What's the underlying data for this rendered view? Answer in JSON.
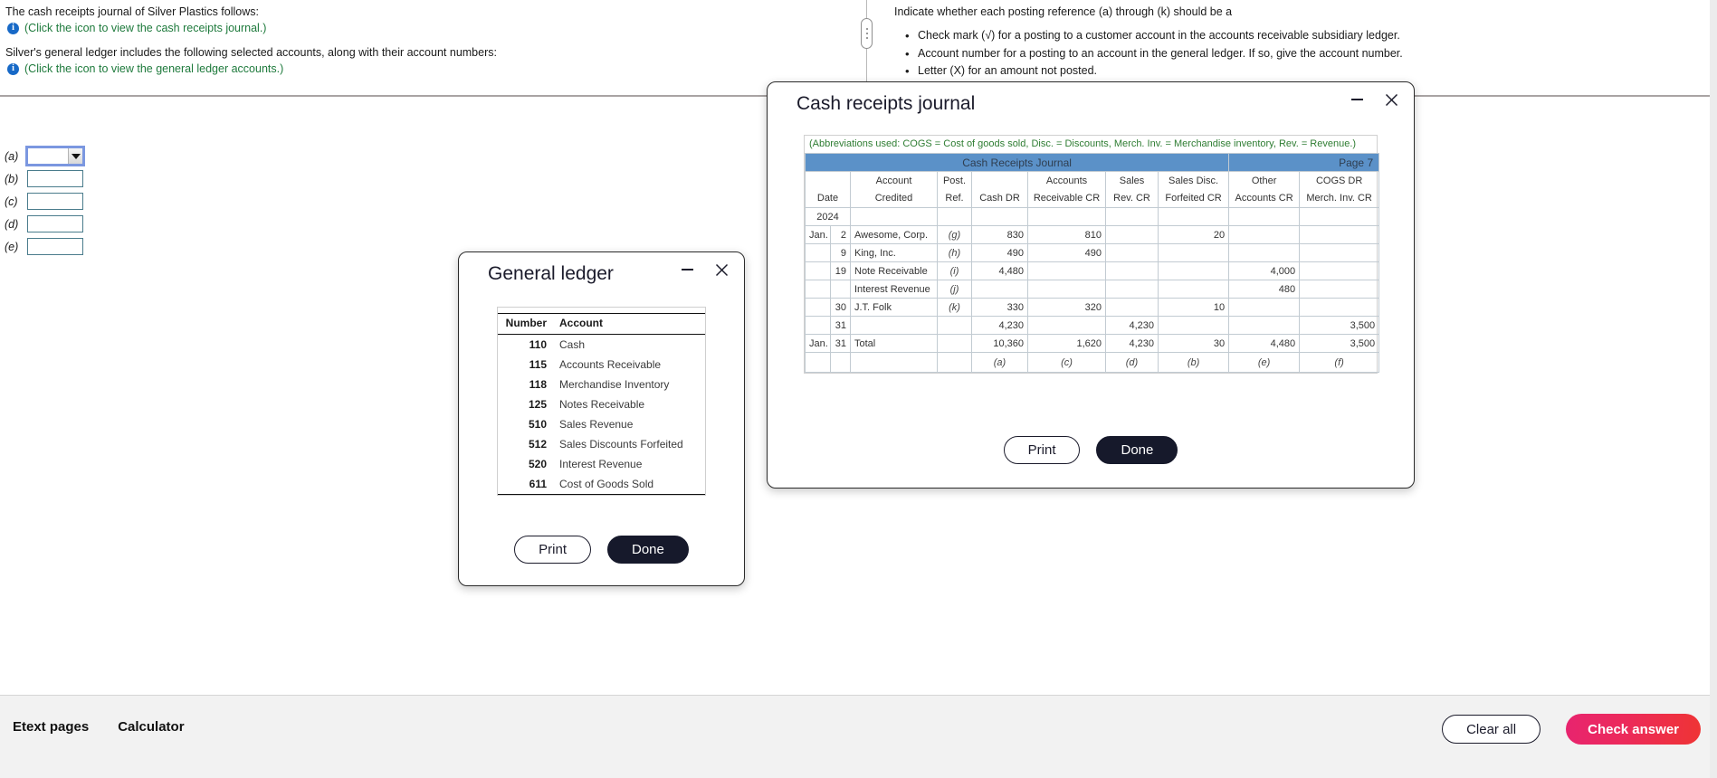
{
  "problem": {
    "left": {
      "line1": "The cash receipts journal of Silver Plastics follows:",
      "hint1": "(Click the icon to view the cash receipts journal.)",
      "line2": "Silver's general ledger includes the following selected accounts, along with their account numbers:",
      "hint2": "(Click the icon to view the general ledger accounts.)"
    },
    "right": {
      "prompt": "Indicate whether each posting reference (a) through (k) should be a",
      "bullets": [
        "Check mark (√) for a posting to a customer account in the accounts receivable subsidiary ledger.",
        "Account number for a posting to an account in the general ledger. If so, give the account number.",
        "Letter (X) for an amount not posted."
      ]
    }
  },
  "answers": {
    "rows": [
      {
        "label": "(a)",
        "value": "",
        "type": "dropdown",
        "focused": true
      },
      {
        "label": "(b)",
        "value": "",
        "type": "text",
        "focused": false
      },
      {
        "label": "(c)",
        "value": "",
        "type": "text",
        "focused": false
      },
      {
        "label": "(d)",
        "value": "",
        "type": "text",
        "focused": false
      },
      {
        "label": "(e)",
        "value": "",
        "type": "text",
        "focused": false
      }
    ]
  },
  "general_ledger_dialog": {
    "title": "General ledger",
    "columns": [
      "Number",
      "Account"
    ],
    "rows": [
      {
        "number": "110",
        "account": "Cash"
      },
      {
        "number": "115",
        "account": "Accounts Receivable"
      },
      {
        "number": "118",
        "account": "Merchandise Inventory"
      },
      {
        "number": "125",
        "account": "Notes Receivable"
      },
      {
        "number": "510",
        "account": "Sales Revenue"
      },
      {
        "number": "512",
        "account": "Sales Discounts Forfeited"
      },
      {
        "number": "520",
        "account": "Interest Revenue"
      },
      {
        "number": "611",
        "account": "Cost of Goods Sold"
      }
    ],
    "print_label": "Print",
    "done_label": "Done"
  },
  "cash_receipts_dialog": {
    "title": "Cash receipts journal",
    "abbreviations": "(Abbreviations used: COGS = Cost of goods sold, Disc. = Discounts, Merch. Inv. = Merchandise inventory, Rev. = Revenue.)",
    "banner_title": "Cash Receipts Journal",
    "page_label": "Page 7",
    "headers_top": [
      "",
      "Account",
      "Post.",
      "",
      "Accounts",
      "Sales",
      "Sales Disc.",
      "Other",
      "COGS DR"
    ],
    "headers_bottom": [
      "Date",
      "Credited",
      "Ref.",
      "Cash DR",
      "Receivable CR",
      "Rev. CR",
      "Forfeited CR",
      "Accounts CR",
      "Merch. Inv. CR"
    ],
    "year_row": "2024",
    "rows": [
      {
        "month": "Jan.",
        "day": "2",
        "account": "Awesome, Corp.",
        "ref": "(g)",
        "cash": "830",
        "ar": "810",
        "sales": "",
        "disc": "20",
        "other": "",
        "cogs": ""
      },
      {
        "month": "",
        "day": "9",
        "account": "King, Inc.",
        "ref": "(h)",
        "cash": "490",
        "ar": "490",
        "sales": "",
        "disc": "",
        "other": "",
        "cogs": ""
      },
      {
        "month": "",
        "day": "19",
        "account": "Note Receivable",
        "ref": "(i)",
        "cash": "4,480",
        "ar": "",
        "sales": "",
        "disc": "",
        "other": "4,000",
        "cogs": ""
      },
      {
        "month": "",
        "day": "",
        "account": "Interest Revenue",
        "ref": "(j)",
        "cash": "",
        "ar": "",
        "sales": "",
        "disc": "",
        "other": "480",
        "cogs": ""
      },
      {
        "month": "",
        "day": "30",
        "account": "J.T. Folk",
        "ref": "(k)",
        "cash": "330",
        "ar": "320",
        "sales": "",
        "disc": "10",
        "other": "",
        "cogs": ""
      },
      {
        "month": "",
        "day": "31",
        "account": "",
        "ref": "",
        "cash": "4,230",
        "ar": "",
        "sales": "4,230",
        "disc": "",
        "other": "",
        "cogs": "3,500"
      }
    ],
    "total_row": {
      "month": "Jan.",
      "day": "31",
      "account": "Total",
      "ref": "",
      "cash": "10,360",
      "ar": "1,620",
      "sales": "4,230",
      "disc": "30",
      "other": "4,480",
      "cogs": "3,500"
    },
    "letters_row": {
      "cash": "(a)",
      "ar": "(c)",
      "sales": "(d)",
      "disc": "(b)",
      "other": "(e)",
      "cogs": "(f)"
    },
    "print_label": "Print",
    "done_label": "Done"
  },
  "bottom_bar": {
    "etext_label": "Etext pages",
    "calculator_label": "Calculator",
    "clear_all_label": "Clear all",
    "check_answer_label": "Check answer"
  },
  "colors": {
    "banner_blue": "#5b91c8",
    "hint_green": "#1e7a3c",
    "abbrev_green": "#2e7d32",
    "check_answer_gradient_start": "#e8246f",
    "check_answer_gradient_end": "#ef3434",
    "dark_button": "#16192b",
    "info_icon_blue": "#1769c7"
  }
}
